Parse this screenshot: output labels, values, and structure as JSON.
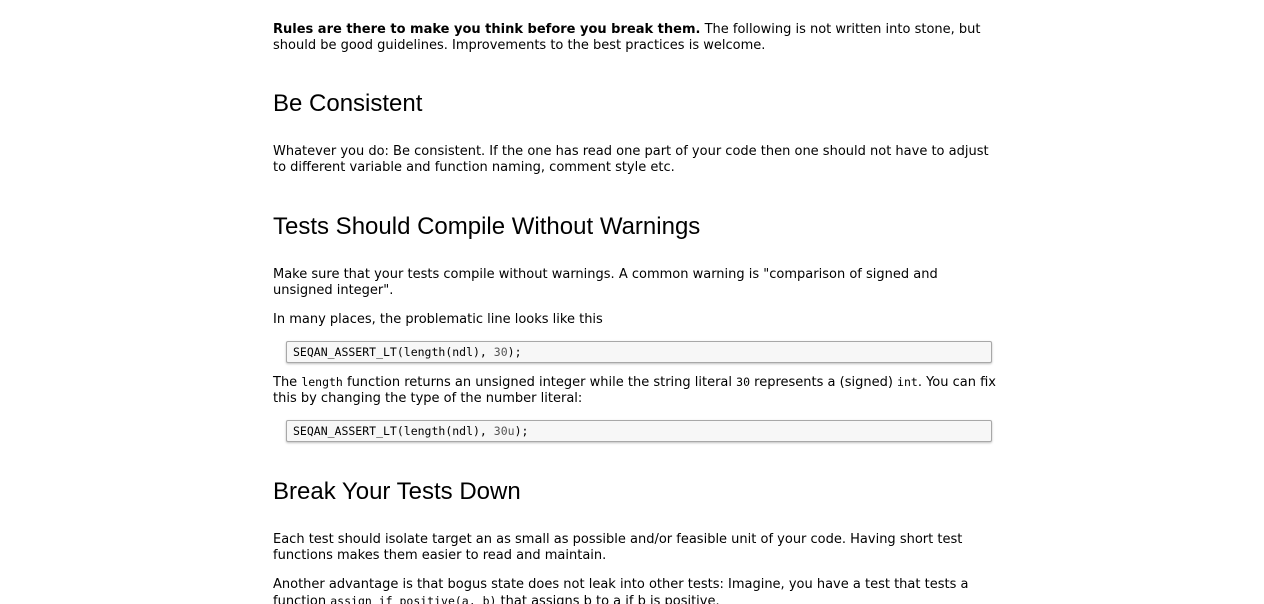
{
  "intro": {
    "bold": "Rules are there to make you think before you break them.",
    "rest": " The following is not written into stone, but should be good guidelines. Improvements to the best practices is welcome."
  },
  "section_consistent": {
    "heading": "Be Consistent",
    "para": "Whatever you do: Be consistent. If the one has read one part of your code then one should not have to adjust to different variable and function naming, comment style etc."
  },
  "section_warnings": {
    "heading": "Tests Should Compile Without Warnings",
    "para1": "Make sure that your tests compile without warnings. A common warning is \"comparison of signed and unsigned integer\".",
    "para2": "In many places, the problematic line looks like this",
    "code1_prefix": "SEQAN_ASSERT_LT(length(ndl), ",
    "code1_num": "30",
    "code1_suffix": ");",
    "para3_a": "The ",
    "para3_code1": "length",
    "para3_b": " function returns an unsigned integer while the string literal ",
    "para3_code2": "30",
    "para3_c": " represents a (signed) ",
    "para3_code3": "int",
    "para3_d": ". You can fix this by changing the type of the number literal:",
    "code2_prefix": "SEQAN_ASSERT_LT(length(ndl), ",
    "code2_num": "30u",
    "code2_suffix": ");"
  },
  "section_break": {
    "heading": "Break Your Tests Down",
    "para1": "Each test should isolate target an as small as possible and/or feasible unit of your code. Having short test functions makes them easier to read and maintain.",
    "para2_a": "Another advantage is that bogus state does not leak into other tests: Imagine, you have a test that tests a function ",
    "para2_code": "assign_if_positive(a, b)",
    "para2_b": " that assigns b to a if b is positive."
  }
}
